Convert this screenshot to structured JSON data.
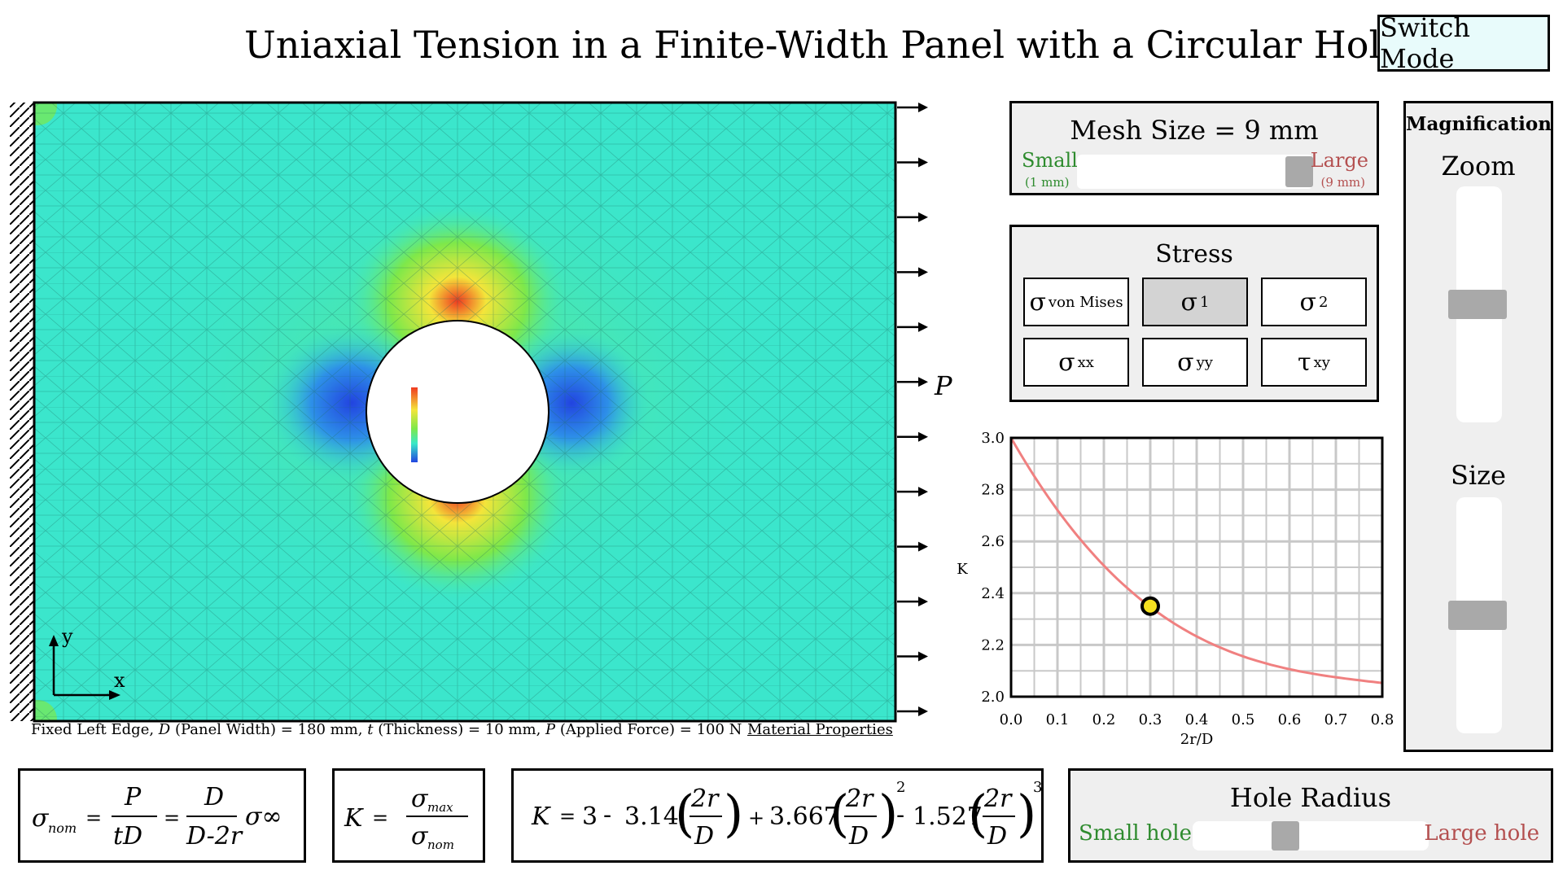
{
  "header": {
    "title": "Uniaxial Tension in a Finite-Width Panel with a Circular Hole",
    "switch_label": "Switch Mode"
  },
  "panel": {
    "caption_parts": {
      "a": "Fixed Left Edge, ",
      "D": "D",
      "b": " (Panel Width) = 180 mm, ",
      "t": "t",
      "c": " (Thickness) = 10 mm, ",
      "P": "P",
      "d": " (Applied Force) = 100 N"
    },
    "material_link": "Material Properties",
    "load_label": "P",
    "axis_x": "x",
    "axis_y": "y",
    "arrow_count": 12,
    "colors": {
      "field": "#39e8c8",
      "blue": "#2244e0",
      "yellow": "#f4e53a",
      "red": "#f03a20",
      "green": "#7ee84a"
    }
  },
  "mesh": {
    "title": "Mesh Size = 9 mm",
    "small_label": "Small",
    "small_sub": "(1 mm)",
    "large_label": "Large",
    "large_sub": "(9 mm)",
    "value_fraction": 1.0
  },
  "stress": {
    "title": "Stress",
    "buttons": [
      {
        "sym": "σ",
        "sub": "von Mises",
        "active": false,
        "name": "von-mises"
      },
      {
        "sym": "σ",
        "sub": "1",
        "active": true,
        "name": "sigma-1"
      },
      {
        "sym": "σ",
        "sub": "2",
        "active": false,
        "name": "sigma-2"
      },
      {
        "sym": "σ",
        "sub": "xx",
        "active": false,
        "name": "sigma-xx"
      },
      {
        "sym": "σ",
        "sub": "yy",
        "active": false,
        "name": "sigma-yy"
      },
      {
        "sym": "τ",
        "sub": "xy",
        "active": false,
        "name": "tau-xy"
      }
    ]
  },
  "chart_data": {
    "type": "line",
    "xlabel": "2r/D",
    "ylabel": "K",
    "xlim": [
      0.0,
      0.8
    ],
    "ylim": [
      2.0,
      3.0
    ],
    "xticks": [
      "0.0",
      "0.1",
      "0.2",
      "0.3",
      "0.4",
      "0.5",
      "0.6",
      "0.7",
      "0.8"
    ],
    "yticks": [
      "2.0",
      "2.2",
      "2.4",
      "2.6",
      "2.8",
      "3.0"
    ],
    "grid": true,
    "curve": "K = 3 - 3.14x + 3.667x^2 - 1.527x^3",
    "line_color": "#f08080",
    "marker": {
      "x": 0.3,
      "y": 2.35,
      "color": "#f5e020"
    }
  },
  "magnification": {
    "title": "Magnification",
    "zoom_label": "Zoom",
    "size_label": "Size",
    "zoom_fraction": 0.5,
    "size_fraction": 0.5
  },
  "formulas": {
    "nom_lhs": "σ",
    "nom_sub": "nom",
    "eq": "=",
    "P": "P",
    "tD": "tD",
    "D": "D",
    "D2r": "D-2r",
    "sig_inf": "σ∞",
    "K": "K",
    "sig_max": "σ",
    "max_sub": "max",
    "c3": "3",
    "minus": "-",
    "plus": "+",
    "a1": "3.14",
    "a2": "3.667",
    "a3": "1.527",
    "two_r": "2r",
    "p2": "2",
    "p3": "3"
  },
  "hole": {
    "title": "Hole Radius",
    "small_label": "Small hole",
    "large_label": "Large hole",
    "value_fraction": 0.38
  }
}
